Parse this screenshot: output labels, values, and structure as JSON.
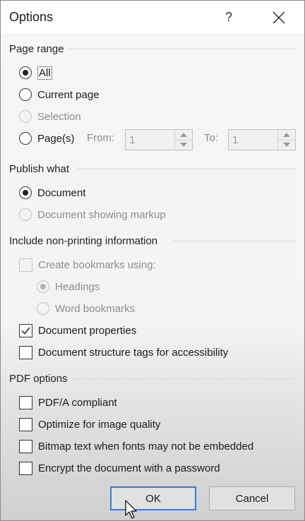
{
  "window": {
    "title": "Options",
    "help_glyph": "?"
  },
  "page_range": {
    "label": "Page range",
    "options": [
      {
        "label": "All",
        "checked": true,
        "disabled": false
      },
      {
        "label": "Current page",
        "checked": false,
        "disabled": false
      },
      {
        "label": "Selection",
        "checked": false,
        "disabled": true
      },
      {
        "label": "Page(s)",
        "checked": false,
        "disabled": false
      }
    ],
    "from_label": "From:",
    "from_value": "1",
    "to_label": "To:",
    "to_value": "1"
  },
  "publish_what": {
    "label": "Publish what",
    "options": [
      {
        "label": "Document",
        "checked": true,
        "disabled": false
      },
      {
        "label": "Document showing markup",
        "checked": false,
        "disabled": true
      }
    ]
  },
  "non_printing": {
    "label": "Include non-printing information",
    "create_bookmarks": {
      "label": "Create bookmarks using:",
      "checked": false,
      "disabled": true
    },
    "bookmark_options": [
      {
        "label": "Headings",
        "checked": true,
        "disabled": true
      },
      {
        "label": "Word bookmarks",
        "checked": false,
        "disabled": true
      }
    ],
    "document_properties": {
      "label": "Document properties",
      "checked": true
    },
    "structure_tags": {
      "label": "Document structure tags for accessibility",
      "checked": false
    }
  },
  "pdf_options": {
    "label": "PDF options",
    "items": [
      {
        "label": "PDF/A compliant",
        "checked": false
      },
      {
        "label": "Optimize for image quality",
        "checked": false
      },
      {
        "label": "Bitmap text when fonts may not be embedded",
        "checked": false
      },
      {
        "label": "Encrypt the document with a password",
        "checked": false
      }
    ]
  },
  "buttons": {
    "ok": "OK",
    "cancel": "Cancel"
  }
}
